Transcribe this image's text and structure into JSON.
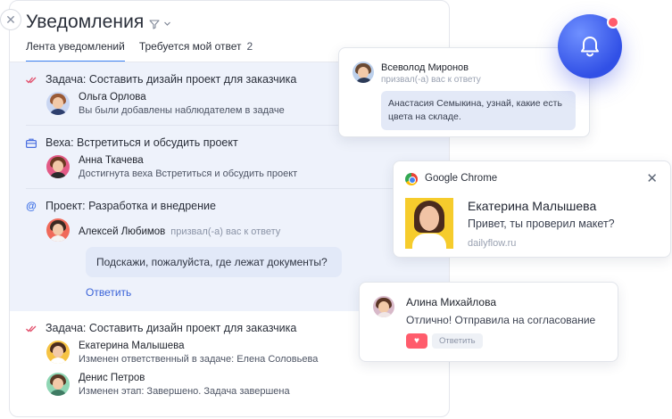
{
  "panel": {
    "title": "Уведомления",
    "close_icon": "close-icon",
    "filter_icon": "filter-icon",
    "tabs": [
      {
        "label": "Лента уведомлений",
        "active": true
      },
      {
        "label": "Требуется мой ответ",
        "count": "2",
        "active": false
      }
    ],
    "items": [
      {
        "type_icon": "double-check-icon",
        "title": "Задача: Составить дизайн проект для заказчика",
        "rows": [
          {
            "name": "Ольга Орлова",
            "text": "Вы были добавлены наблюдателем в задаче"
          }
        ]
      },
      {
        "type_icon": "briefcase-icon",
        "title": "Веха: Встретиться и обсудить проект",
        "rows": [
          {
            "name": "Анна Ткачева",
            "text": "Достигнута веха Встретиться и обсудить проект"
          }
        ]
      },
      {
        "type_icon": "at-icon",
        "title": "Проект: Разработка и внедрение",
        "rows": [
          {
            "name": "Алексей Любимов",
            "mention": "призвал(-а) вас к ответу"
          }
        ],
        "bubble": "Подскажи, пожалуйста, где лежат документы?",
        "reply_label": "Ответить"
      },
      {
        "type_icon": "double-check-icon",
        "title": "Задача: Составить дизайн проект для заказчика",
        "rows": [
          {
            "name": "Екатерина Малышева",
            "text": "Изменен ответственный в задаче: Елена Соловьева"
          },
          {
            "name": "Денис Петров",
            "text": "Изменен этап: Завершено. Задача завершена"
          }
        ]
      }
    ]
  },
  "card_vsevolod": {
    "name": "Всеволод Миронов",
    "mention": "призвал(-а) вас к ответу",
    "message": "Анастасия Семыкина, узнай, какие есть цвета на складе."
  },
  "bell": {
    "icon": "bell-icon",
    "badge_color": "#ff5c6c"
  },
  "card_chrome": {
    "app": "Google Chrome",
    "name": "Екатерина Малышева",
    "message": "Привет, ты проверил макет?",
    "site": "dailyflow.ru"
  },
  "card_alina": {
    "name": "Алина Михайлова",
    "message": "Отлично! Отправила на согласование",
    "reply_label": "Ответить",
    "like_icon": "heart-icon"
  },
  "colors": {
    "accent": "#3b82f6",
    "link": "#3a63d8",
    "highlight_bg": "#eef2fb",
    "bell": "#3150e6"
  }
}
